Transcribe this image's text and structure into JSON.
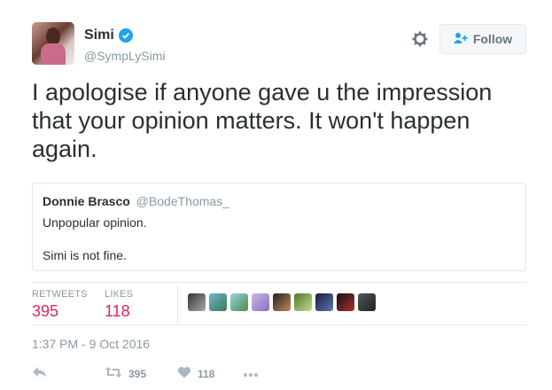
{
  "tweet": {
    "author": {
      "name": "Simi",
      "handle": "@SympLySimi",
      "verified": true
    },
    "follow_label": "Follow",
    "text": "I apologise if anyone gave u the impression that your opinion matters. It won't happen again.",
    "quoted": {
      "name": "Donnie Brasco",
      "handle": "@BodeThomas_",
      "lines": [
        "Unpopular opinion.",
        "Simi is not fine."
      ]
    },
    "stats": {
      "retweets_label": "RETWEETS",
      "retweets": "395",
      "likes_label": "LIKES",
      "likes": "118"
    },
    "timestamp": "1:37 PM - 9 Oct 2016",
    "actions": {
      "retweet_count": "395",
      "like_count": "118"
    }
  },
  "colors": {
    "accent": "#1da1f2",
    "like": "#e0245e",
    "muted": "#8899a6",
    "border": "#e1e8ed"
  },
  "icons": [
    "verified-icon",
    "gear-icon",
    "follow-person-icon",
    "reply-icon",
    "retweet-icon",
    "heart-icon",
    "more-icon"
  ]
}
